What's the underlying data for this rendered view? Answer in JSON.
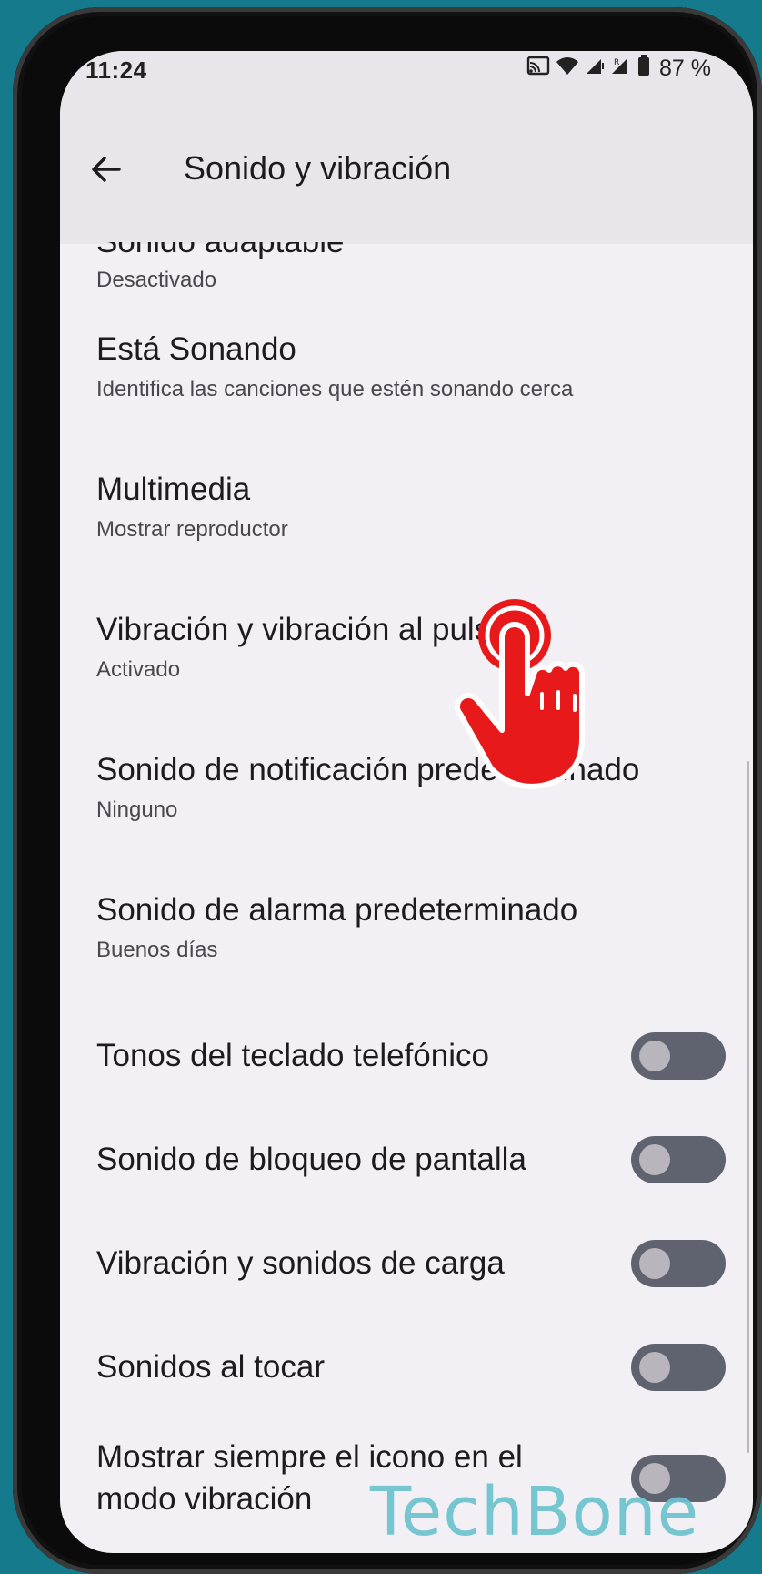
{
  "status_bar": {
    "time": "11:24",
    "battery_percent": "87 %",
    "icons": [
      "cast-icon",
      "wifi-icon",
      "signal-icon",
      "signal-roaming-icon",
      "battery-icon"
    ]
  },
  "app_bar": {
    "back_icon": "arrow-left-icon",
    "title": "Sonido y vibración"
  },
  "settings": {
    "partial_item": {
      "title": "Sonido adaptable",
      "subtitle": "Desactivado"
    },
    "items": [
      {
        "title": "Está Sonando",
        "subtitle": "Identifica las canciones que estén sonando cerca"
      },
      {
        "title": "Multimedia",
        "subtitle": "Mostrar reproductor"
      },
      {
        "title": "Vibración y vibración al pulsar",
        "subtitle": "Activado"
      },
      {
        "title": "Sonido de notificación predeterminado",
        "subtitle": "Ninguno"
      },
      {
        "title": "Sonido de alarma predeterminado",
        "subtitle": "Buenos días"
      }
    ],
    "toggles": [
      {
        "title": "Tonos del teclado telefónico",
        "state": "off"
      },
      {
        "title": "Sonido de bloqueo de pantalla",
        "state": "off"
      },
      {
        "title": "Vibración y sonidos de carga",
        "state": "off"
      },
      {
        "title": "Sonidos al tocar",
        "state": "off"
      },
      {
        "title": "Mostrar siempre el icono en el modo vibración",
        "state": "off"
      }
    ]
  },
  "overlay": {
    "tap_indicator_icon": "tap-hand-icon",
    "tap_color": "#e8191a"
  },
  "watermark": "TechBone",
  "colors": {
    "background": "#157a8c",
    "screen": "#f2f0f4",
    "appbar": "#e8e6ea",
    "switch_track": "#5f6370"
  }
}
